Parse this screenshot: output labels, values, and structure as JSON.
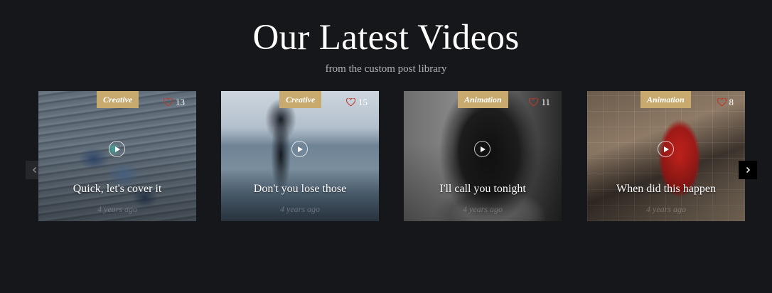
{
  "section": {
    "title": "Our Latest Videos",
    "subtitle": "from the custom post library"
  },
  "carousel": {
    "prev_icon": "chevron-left-icon",
    "next_icon": "chevron-right-icon"
  },
  "videos": [
    {
      "category": "Creative",
      "likes": "13",
      "title": "Quick, let's cover it",
      "date": "4 years ago"
    },
    {
      "category": "Creative",
      "likes": "15",
      "title": "Don't you lose those",
      "date": "4 years ago"
    },
    {
      "category": "Animation",
      "likes": "11",
      "title": "I'll call you tonight",
      "date": "4 years ago"
    },
    {
      "category": "Animation",
      "likes": "8",
      "title": "When did this happen",
      "date": "4 years ago"
    }
  ],
  "colors": {
    "background": "#16171b",
    "category_badge": "#c8a96e",
    "heart": "#c0392b"
  }
}
